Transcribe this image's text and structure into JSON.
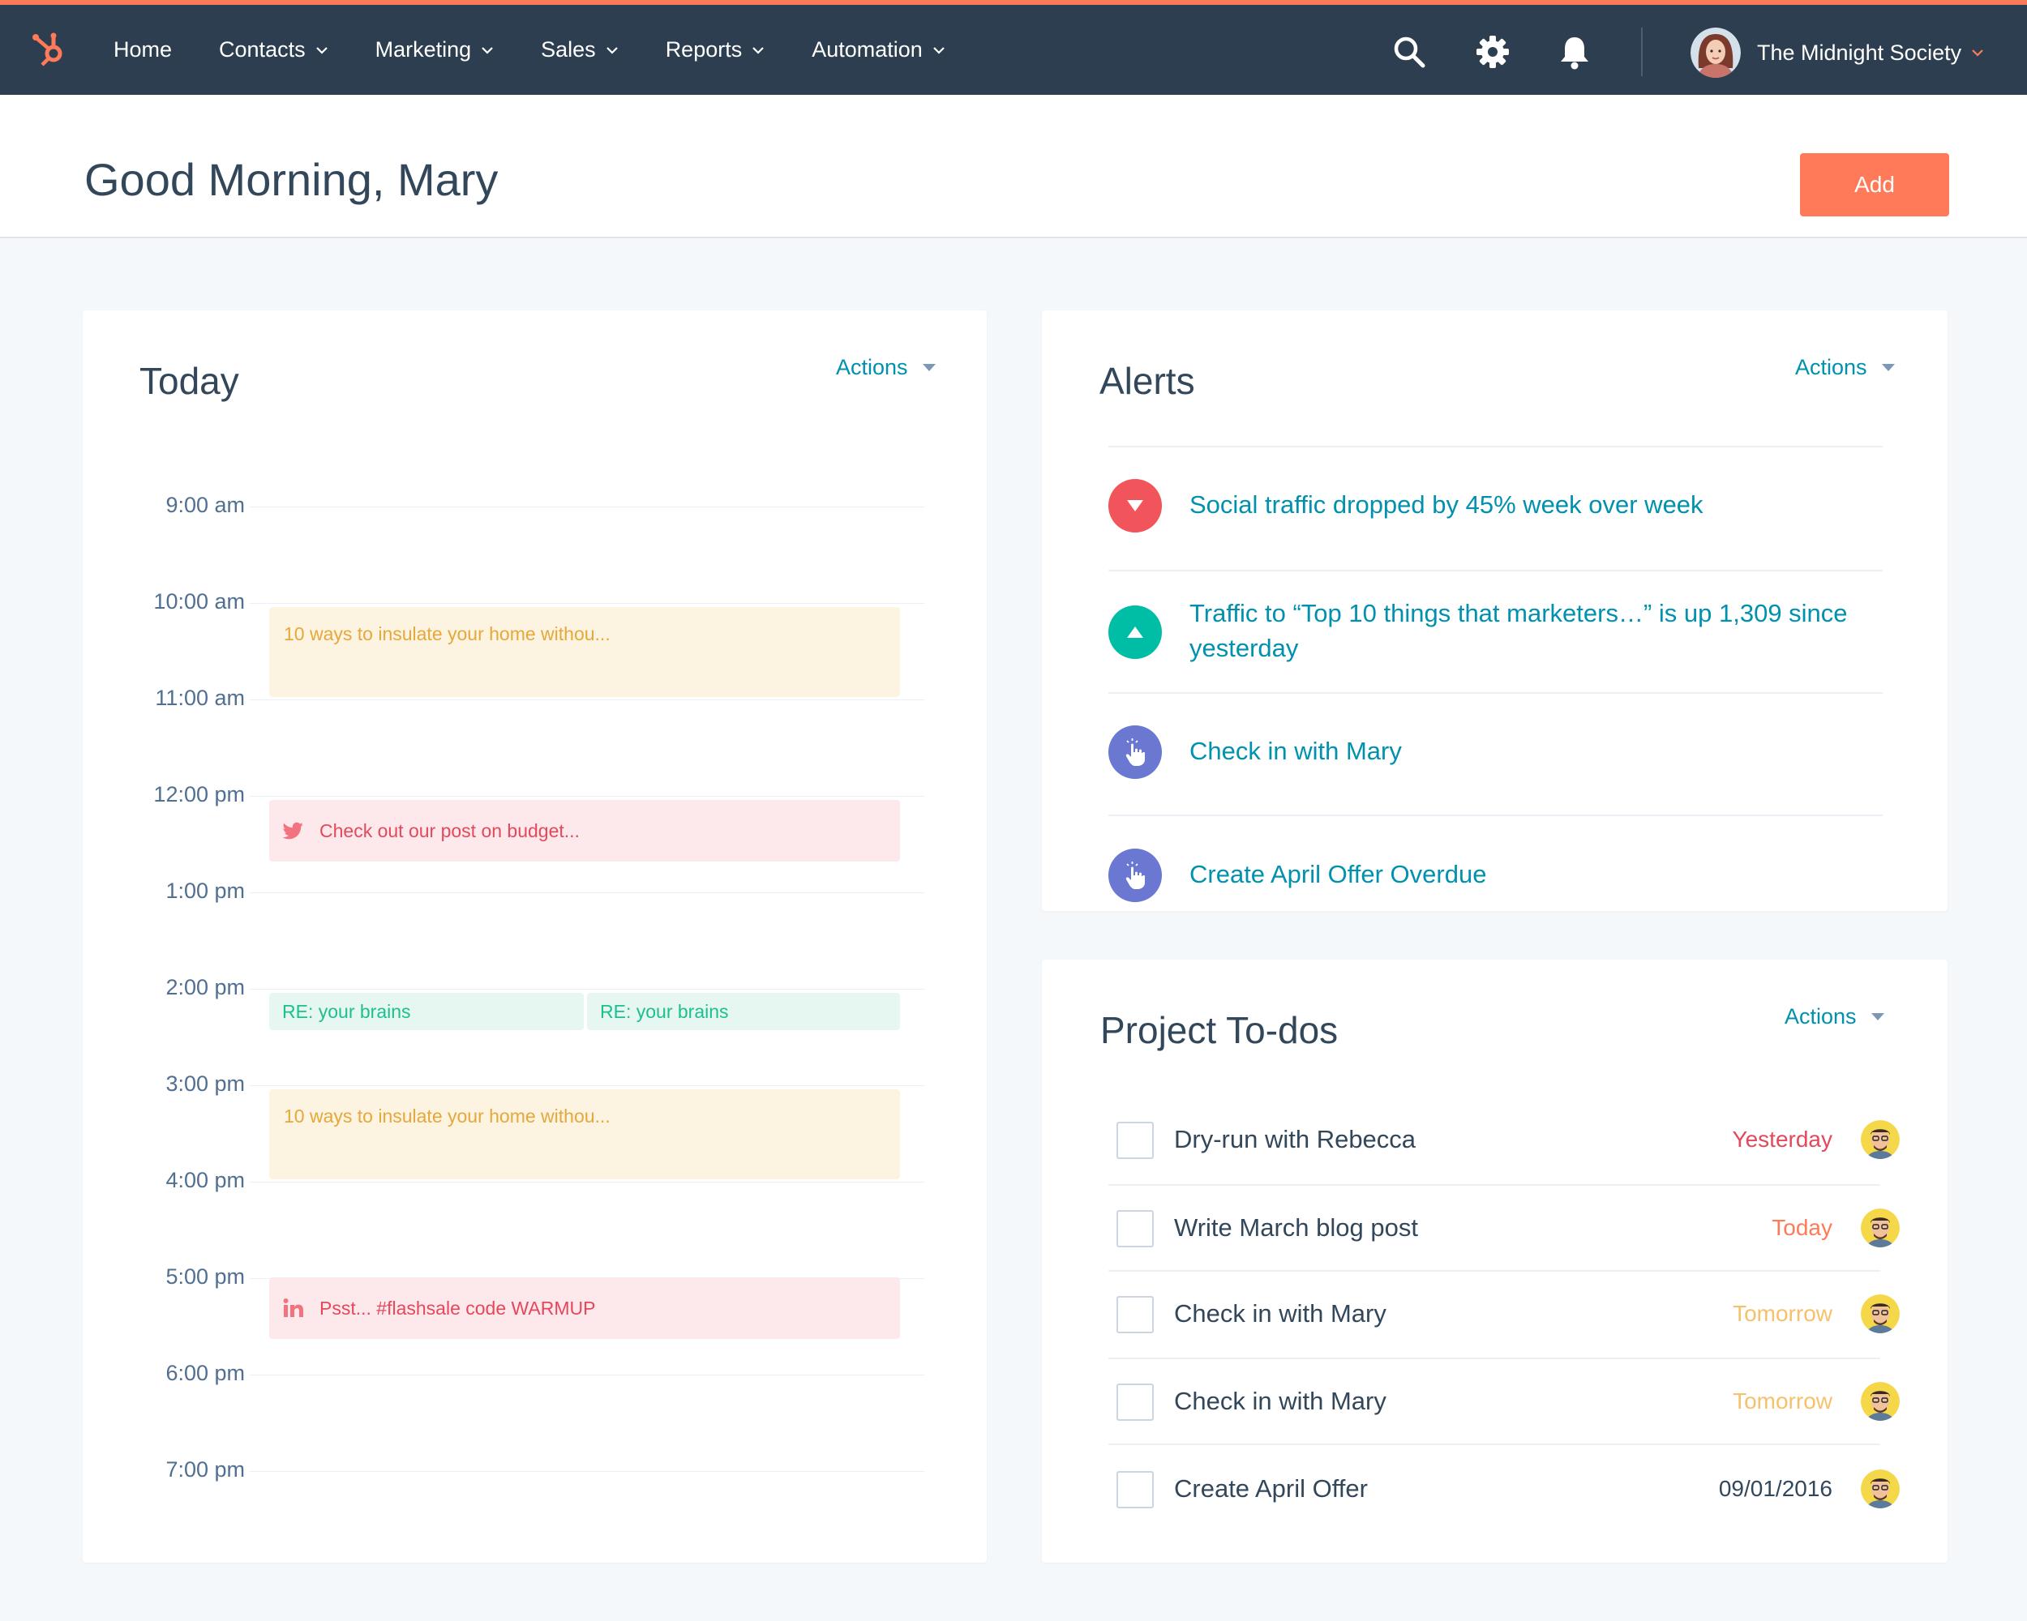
{
  "nav": {
    "items": [
      {
        "label": "Home",
        "has_dropdown": false
      },
      {
        "label": "Contacts",
        "has_dropdown": true
      },
      {
        "label": "Marketing",
        "has_dropdown": true
      },
      {
        "label": "Sales",
        "has_dropdown": true
      },
      {
        "label": "Reports",
        "has_dropdown": true
      },
      {
        "label": "Automation",
        "has_dropdown": true
      }
    ],
    "account_name": "The Midnight Society",
    "icons": [
      "hubspot-logo-icon",
      "search-icon",
      "gear-icon",
      "bell-icon"
    ]
  },
  "header": {
    "title": "Good Morning, Mary",
    "add_label": "Add"
  },
  "today": {
    "title": "Today",
    "actions_label": "Actions",
    "times": [
      "9:00 am",
      "10:00 am",
      "11:00 am",
      "12:00 pm",
      "1:00 pm",
      "2:00 pm",
      "3:00 pm",
      "4:00 pm",
      "5:00 pm",
      "6:00 pm",
      "7:00 pm"
    ],
    "events": [
      {
        "label": "10 ways to insulate your home withou...",
        "kind": "blog",
        "color": "yellow"
      },
      {
        "label": "Check out our post on budget...",
        "kind": "twitter",
        "color": "pink"
      },
      {
        "label": "RE: your brains",
        "kind": "email",
        "color": "green"
      },
      {
        "label": "RE: your brains",
        "kind": "email",
        "color": "green"
      },
      {
        "label": "10 ways to insulate your home withou...",
        "kind": "blog",
        "color": "yellow"
      },
      {
        "label": "Psst... #flashsale code WARMUP",
        "kind": "linkedin",
        "color": "pink"
      }
    ]
  },
  "alerts": {
    "title": "Alerts",
    "actions_label": "Actions",
    "items": [
      {
        "text": "Social traffic dropped by 45% week over week",
        "icon": "arrow-down-icon",
        "color": "#f2545b"
      },
      {
        "text": "Traffic to “Top 10 things that marketers…” is up 1,309 since yesterday",
        "icon": "arrow-up-icon",
        "color": "#00bda5"
      },
      {
        "text": "Check in with Mary",
        "icon": "hand-pointer-icon",
        "color": "#6a78d1"
      },
      {
        "text": "Create April Offer Overdue",
        "icon": "hand-pointer-icon",
        "color": "#6a78d1"
      }
    ]
  },
  "todos": {
    "title": "Project To-dos",
    "actions_label": "Actions",
    "items": [
      {
        "label": "Dry-run with Rebecca",
        "date": "Yesterday",
        "date_color": "#e4485c"
      },
      {
        "label": "Write March blog post",
        "date": "Today",
        "date_color": "#ff7a59"
      },
      {
        "label": "Check in with Mary",
        "date": "Tomorrow",
        "date_color": "#f5c26b"
      },
      {
        "label": "Check in with Mary",
        "date": "Tomorrow",
        "date_color": "#f5c26b"
      },
      {
        "label": "Create April Offer",
        "date": "09/01/2016",
        "date_color": "#33475b"
      }
    ]
  },
  "colors": {
    "nav_bg": "#2d3e50",
    "accent": "#ff7a59",
    "link": "#0091ae"
  }
}
